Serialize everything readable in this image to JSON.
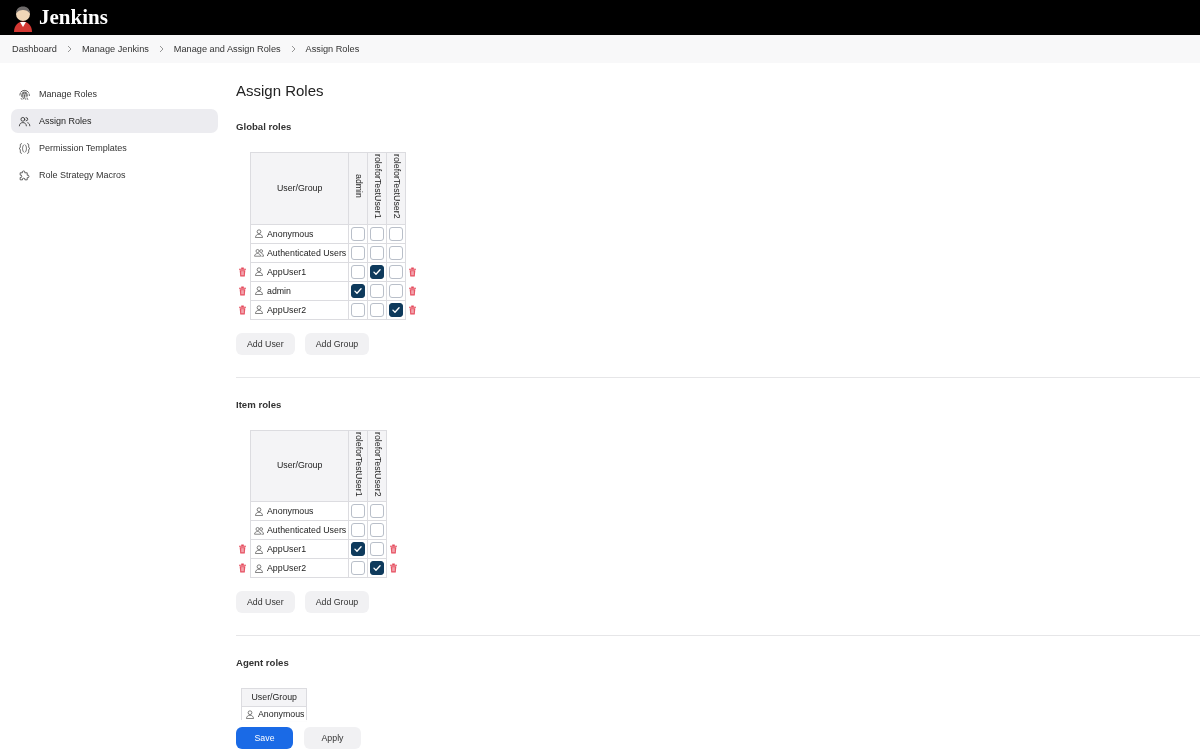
{
  "header": {
    "title": "Jenkins"
  },
  "breadcrumbs": [
    "Dashboard",
    "Manage Jenkins",
    "Manage and Assign Roles",
    "Assign Roles"
  ],
  "sidebar": {
    "items": [
      {
        "label": "Manage Roles",
        "selected": false
      },
      {
        "label": "Assign Roles",
        "selected": true
      },
      {
        "label": "Permission Templates",
        "selected": false
      },
      {
        "label": "Role Strategy Macros",
        "selected": false
      }
    ]
  },
  "page_title": "Assign Roles",
  "sections": [
    {
      "title": "Global roles",
      "table": {
        "user_column": "User/Group",
        "roles": [
          "admin",
          "roleforTestUser1",
          "roleforTestUser2"
        ],
        "rows": [
          {
            "name": "Anonymous",
            "kind": "user",
            "deletable": false,
            "cells": [
              {
                "checked": false
              },
              {
                "checked": false
              },
              {
                "checked": false
              }
            ]
          },
          {
            "name": "Authenticated Users",
            "kind": "group",
            "deletable": false,
            "cells": [
              {
                "checked": false
              },
              {
                "checked": false
              },
              {
                "checked": false
              }
            ]
          },
          {
            "name": "AppUser1",
            "kind": "user",
            "deletable": true,
            "cells": [
              {
                "checked": false
              },
              {
                "checked": true
              },
              {
                "checked": false
              }
            ]
          },
          {
            "name": "admin",
            "kind": "user",
            "deletable": true,
            "cells": [
              {
                "checked": true
              },
              {
                "checked": false
              },
              {
                "checked": false
              }
            ]
          },
          {
            "name": "AppUser2",
            "kind": "user",
            "deletable": true,
            "cells": [
              {
                "checked": false
              },
              {
                "checked": false
              },
              {
                "checked": true
              }
            ]
          }
        ]
      },
      "buttons": [
        "Add User",
        "Add Group"
      ]
    },
    {
      "title": "Item roles",
      "table": {
        "user_column": "User/Group",
        "roles": [
          "roleforTestUser1",
          "roleforTestUser2"
        ],
        "rows": [
          {
            "name": "Anonymous",
            "kind": "user",
            "deletable": false,
            "cells": [
              {
                "checked": false
              },
              {
                "checked": false
              }
            ]
          },
          {
            "name": "Authenticated Users",
            "kind": "group",
            "deletable": false,
            "cells": [
              {
                "checked": false
              },
              {
                "checked": false
              }
            ]
          },
          {
            "name": "AppUser1",
            "kind": "user",
            "deletable": true,
            "cells": [
              {
                "checked": true
              },
              {
                "checked": false
              }
            ]
          },
          {
            "name": "AppUser2",
            "kind": "user",
            "deletable": true,
            "cells": [
              {
                "checked": false
              },
              {
                "checked": true
              }
            ]
          }
        ]
      },
      "buttons": [
        "Add User",
        "Add Group"
      ]
    },
    {
      "title": "Agent roles",
      "table": {
        "user_column": "User/Group",
        "rows": [
          {
            "name": "Anonymous",
            "kind": "user",
            "deletable": false
          }
        ]
      }
    }
  ],
  "footer": {
    "buttons": [
      {
        "label": "Save",
        "kind": "primary"
      },
      {
        "label": "Apply",
        "kind": "secondary"
      }
    ]
  }
}
